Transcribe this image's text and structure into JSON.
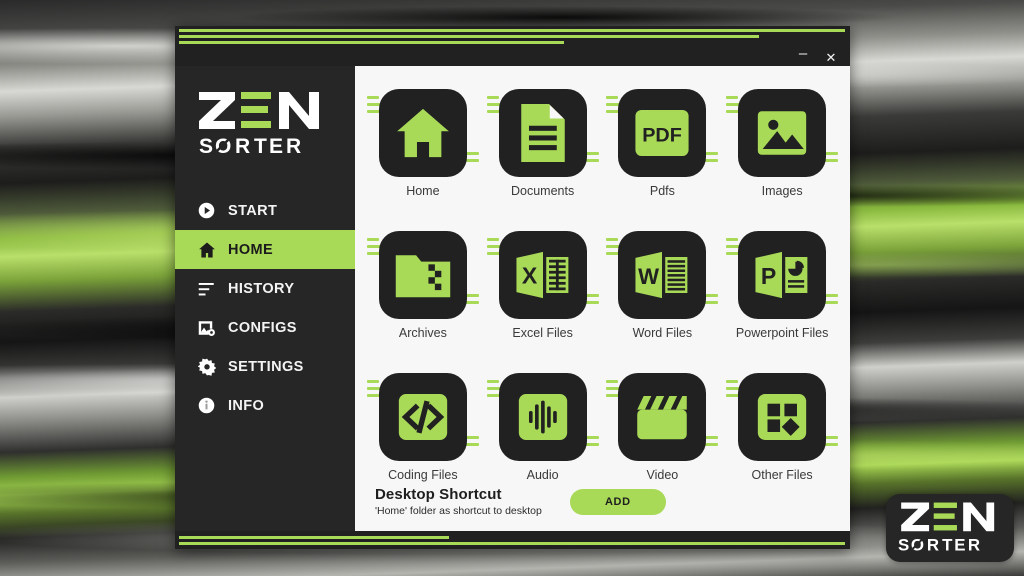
{
  "app": {
    "brand_line1": "ZEN",
    "brand_line2": "SORTER",
    "accent_color": "#a8d957",
    "dark_color": "#212121",
    "content_bg": "#f7f7f7"
  },
  "titlebar": {
    "minimize_label": "–",
    "close_label": "✕"
  },
  "sidebar": {
    "items": [
      {
        "label": "START",
        "icon": "play-circle-icon",
        "active": false
      },
      {
        "label": "HOME",
        "icon": "home-icon",
        "active": true
      },
      {
        "label": "HISTORY",
        "icon": "history-lines-icon",
        "active": false
      },
      {
        "label": "CONFIGS",
        "icon": "image-gear-icon",
        "active": false
      },
      {
        "label": "SETTINGS",
        "icon": "gear-icon",
        "active": false
      },
      {
        "label": "INFO",
        "icon": "info-circle-icon",
        "active": false
      }
    ]
  },
  "main": {
    "tiles": [
      {
        "label": "Home",
        "icon": "home-icon"
      },
      {
        "label": "Documents",
        "icon": "document-icon"
      },
      {
        "label": "Pdfs",
        "icon": "pdf-icon"
      },
      {
        "label": "Images",
        "icon": "image-icon"
      },
      {
        "label": "Archives",
        "icon": "archive-folder-icon"
      },
      {
        "label": "Excel Files",
        "icon": "excel-icon"
      },
      {
        "label": "Word Files",
        "icon": "word-icon"
      },
      {
        "label": "Powerpoint Files",
        "icon": "powerpoint-icon"
      },
      {
        "label": "Coding Files",
        "icon": "code-brackets-icon"
      },
      {
        "label": "Audio",
        "icon": "audio-wave-icon"
      },
      {
        "label": "Video",
        "icon": "clapperboard-icon"
      },
      {
        "label": "Other Files",
        "icon": "shapes-grid-icon"
      }
    ]
  },
  "footer": {
    "title": "Desktop Shortcut",
    "subtitle": "'Home' folder as shortcut to desktop",
    "add_label": "ADD"
  },
  "watermark": {
    "line1": "ZEN",
    "line2": "SORTER"
  }
}
